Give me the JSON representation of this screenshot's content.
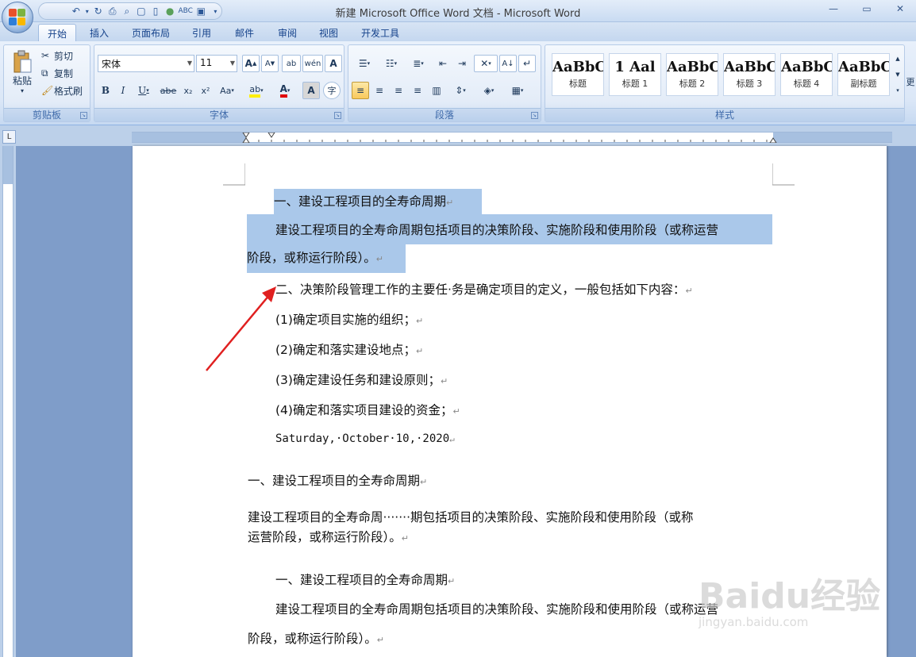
{
  "window": {
    "title": "新建 Microsoft Office Word 文档 - Microsoft Word"
  },
  "qat": {
    "icons": [
      "undo-icon",
      "redo-icon",
      "print-icon",
      "preview-icon",
      "new-icon",
      "doc-icon",
      "circle-icon",
      "abc-icon",
      "save-icon"
    ]
  },
  "tabs": [
    "开始",
    "插入",
    "页面布局",
    "引用",
    "邮件",
    "审阅",
    "视图",
    "开发工具"
  ],
  "ribbon": {
    "clipboard": {
      "label": "剪贴板",
      "paste": "粘贴",
      "cut": "剪切",
      "copy": "复制",
      "format_painter": "格式刷"
    },
    "font": {
      "label": "字体",
      "font_name": "宋体",
      "font_size": "11"
    },
    "paragraph": {
      "label": "段落"
    },
    "styles": {
      "label": "样式",
      "cards": [
        {
          "sample": "AaBbC",
          "name": "标题"
        },
        {
          "sample": "1 Aal",
          "name": "标题 1"
        },
        {
          "sample": "AaBbCc",
          "name": "标题 2"
        },
        {
          "sample": "AaBbC",
          "name": "标题 3"
        },
        {
          "sample": "AaBbCc",
          "name": "标题 4"
        },
        {
          "sample": "AaBbC",
          "name": "副标题"
        }
      ],
      "more": "更"
    }
  },
  "document": {
    "lines": [
      "一、建设工程项目的全寿命周期",
      "建设工程项目的全寿命周期包括项目的决策阶段、实施阶段和使用阶段（或称运营",
      "阶段，或称运行阶段）。",
      "二、决策阶段管理工作的主要任·务是确定项目的定义，一般包括如下内容：",
      "(1)确定项目实施的组织；",
      "(2)确定和落实建设地点；",
      "(3)确定建设任务和建设原则；",
      "(4)确定和落实项目建设的资金；",
      "Saturday,·October·10,·2020",
      "一、建设工程项目的全寿命周期",
      "建设工程项目的全寿命周·······期包括项目的决策阶段、实施阶段和使用阶段（或称",
      "运营阶段，或称运行阶段）。",
      "一、建设工程项目的全寿命周期",
      "建设工程项目的全寿命周期包括项目的决策阶段、实施阶段和使用阶段（或称运营",
      "阶段，或称运行阶段）。"
    ],
    "para_mark": "↵"
  },
  "watermark": {
    "brand": "Baidu经验",
    "url": "jingyan.baidu.com"
  },
  "colors": {
    "selection": "#aac8ea",
    "arrow": "#e02020",
    "ribbon": "#dbe7f7"
  }
}
